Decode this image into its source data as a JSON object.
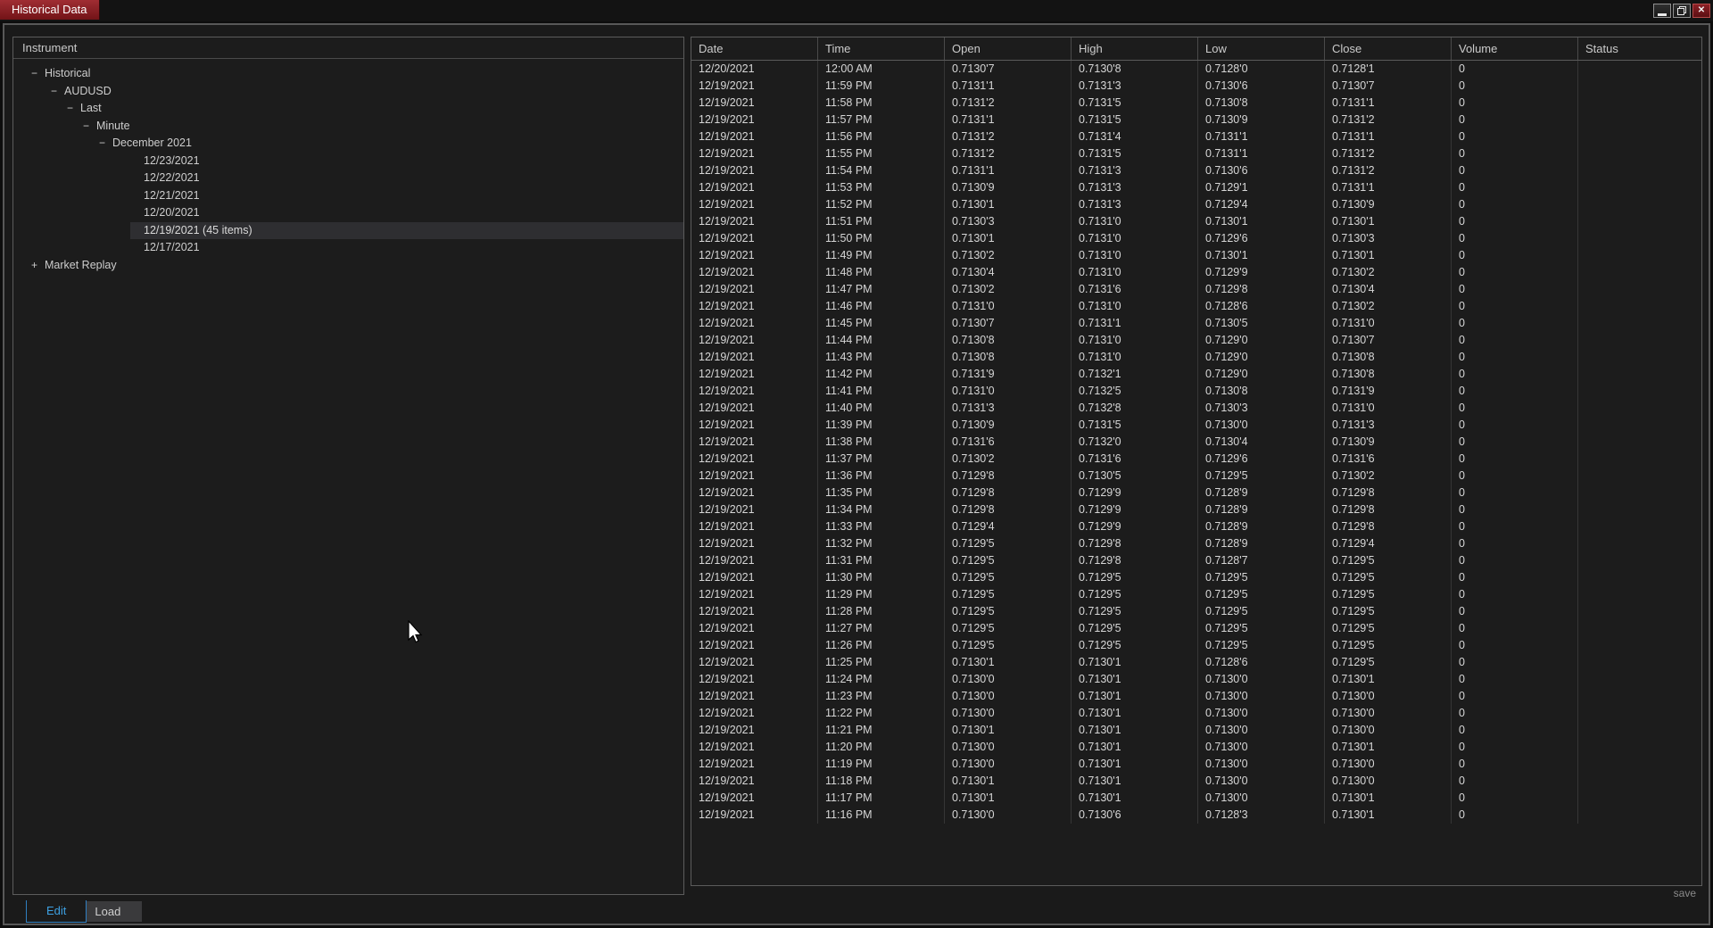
{
  "window": {
    "title": "Historical Data",
    "controls": {
      "minimize": "minimize-window",
      "restore": "restore-window",
      "close": "close-window",
      "close_glyph": "✕"
    }
  },
  "colors": {
    "title_tab_red": "#8e1c21",
    "active_tab_blue": "#3da0e2",
    "selected_tree_row_bg": "#2e2e31",
    "panel_border": "#5c5c5c",
    "background": "#1a1a1a"
  },
  "left_panel": {
    "header": "Instrument",
    "tree": [
      {
        "label": "Historical",
        "glyph": "−",
        "indent": 20,
        "selected": false
      },
      {
        "label": "AUDUSD",
        "glyph": "−",
        "indent": 42,
        "selected": false
      },
      {
        "label": "Last",
        "glyph": "−",
        "indent": 60,
        "selected": false
      },
      {
        "label": "Minute",
        "glyph": "−",
        "indent": 78,
        "selected": false
      },
      {
        "label": "December 2021",
        "glyph": "−",
        "indent": 96,
        "selected": false
      },
      {
        "label": "12/23/2021",
        "glyph": "",
        "indent": 131,
        "selected": false
      },
      {
        "label": "12/22/2021",
        "glyph": "",
        "indent": 131,
        "selected": false
      },
      {
        "label": "12/21/2021",
        "glyph": "",
        "indent": 131,
        "selected": false
      },
      {
        "label": "12/20/2021",
        "glyph": "",
        "indent": 131,
        "selected": false
      },
      {
        "label": "12/19/2021 (45 items)",
        "glyph": "",
        "indent": 131,
        "selected": true
      },
      {
        "label": "12/17/2021",
        "glyph": "",
        "indent": 131,
        "selected": false
      },
      {
        "label": "Market Replay",
        "glyph": "+",
        "indent": 20,
        "selected": false
      }
    ]
  },
  "table": {
    "columns": [
      "Date",
      "Time",
      "Open",
      "High",
      "Low",
      "Close",
      "Volume",
      "Status"
    ],
    "rows": [
      [
        "12/20/2021",
        "12:00 AM",
        "0.7130'7",
        "0.7130'8",
        "0.7128'0",
        "0.7128'1",
        "0",
        ""
      ],
      [
        "12/19/2021",
        "11:59 PM",
        "0.7131'1",
        "0.7131'3",
        "0.7130'6",
        "0.7130'7",
        "0",
        ""
      ],
      [
        "12/19/2021",
        "11:58 PM",
        "0.7131'2",
        "0.7131'5",
        "0.7130'8",
        "0.7131'1",
        "0",
        ""
      ],
      [
        "12/19/2021",
        "11:57 PM",
        "0.7131'1",
        "0.7131'5",
        "0.7130'9",
        "0.7131'2",
        "0",
        ""
      ],
      [
        "12/19/2021",
        "11:56 PM",
        "0.7131'2",
        "0.7131'4",
        "0.7131'1",
        "0.7131'1",
        "0",
        ""
      ],
      [
        "12/19/2021",
        "11:55 PM",
        "0.7131'2",
        "0.7131'5",
        "0.7131'1",
        "0.7131'2",
        "0",
        ""
      ],
      [
        "12/19/2021",
        "11:54 PM",
        "0.7131'1",
        "0.7131'3",
        "0.7130'6",
        "0.7131'2",
        "0",
        ""
      ],
      [
        "12/19/2021",
        "11:53 PM",
        "0.7130'9",
        "0.7131'3",
        "0.7129'1",
        "0.7131'1",
        "0",
        ""
      ],
      [
        "12/19/2021",
        "11:52 PM",
        "0.7130'1",
        "0.7131'3",
        "0.7129'4",
        "0.7130'9",
        "0",
        ""
      ],
      [
        "12/19/2021",
        "11:51 PM",
        "0.7130'3",
        "0.7131'0",
        "0.7130'1",
        "0.7130'1",
        "0",
        ""
      ],
      [
        "12/19/2021",
        "11:50 PM",
        "0.7130'1",
        "0.7131'0",
        "0.7129'6",
        "0.7130'3",
        "0",
        ""
      ],
      [
        "12/19/2021",
        "11:49 PM",
        "0.7130'2",
        "0.7131'0",
        "0.7130'1",
        "0.7130'1",
        "0",
        ""
      ],
      [
        "12/19/2021",
        "11:48 PM",
        "0.7130'4",
        "0.7131'0",
        "0.7129'9",
        "0.7130'2",
        "0",
        ""
      ],
      [
        "12/19/2021",
        "11:47 PM",
        "0.7130'2",
        "0.7131'6",
        "0.7129'8",
        "0.7130'4",
        "0",
        ""
      ],
      [
        "12/19/2021",
        "11:46 PM",
        "0.7131'0",
        "0.7131'0",
        "0.7128'6",
        "0.7130'2",
        "0",
        ""
      ],
      [
        "12/19/2021",
        "11:45 PM",
        "0.7130'7",
        "0.7131'1",
        "0.7130'5",
        "0.7131'0",
        "0",
        ""
      ],
      [
        "12/19/2021",
        "11:44 PM",
        "0.7130'8",
        "0.7131'0",
        "0.7129'0",
        "0.7130'7",
        "0",
        ""
      ],
      [
        "12/19/2021",
        "11:43 PM",
        "0.7130'8",
        "0.7131'0",
        "0.7129'0",
        "0.7130'8",
        "0",
        ""
      ],
      [
        "12/19/2021",
        "11:42 PM",
        "0.7131'9",
        "0.7132'1",
        "0.7129'0",
        "0.7130'8",
        "0",
        ""
      ],
      [
        "12/19/2021",
        "11:41 PM",
        "0.7131'0",
        "0.7132'5",
        "0.7130'8",
        "0.7131'9",
        "0",
        ""
      ],
      [
        "12/19/2021",
        "11:40 PM",
        "0.7131'3",
        "0.7132'8",
        "0.7130'3",
        "0.7131'0",
        "0",
        ""
      ],
      [
        "12/19/2021",
        "11:39 PM",
        "0.7130'9",
        "0.7131'5",
        "0.7130'0",
        "0.7131'3",
        "0",
        ""
      ],
      [
        "12/19/2021",
        "11:38 PM",
        "0.7131'6",
        "0.7132'0",
        "0.7130'4",
        "0.7130'9",
        "0",
        ""
      ],
      [
        "12/19/2021",
        "11:37 PM",
        "0.7130'2",
        "0.7131'6",
        "0.7129'6",
        "0.7131'6",
        "0",
        ""
      ],
      [
        "12/19/2021",
        "11:36 PM",
        "0.7129'8",
        "0.7130'5",
        "0.7129'5",
        "0.7130'2",
        "0",
        ""
      ],
      [
        "12/19/2021",
        "11:35 PM",
        "0.7129'8",
        "0.7129'9",
        "0.7128'9",
        "0.7129'8",
        "0",
        ""
      ],
      [
        "12/19/2021",
        "11:34 PM",
        "0.7129'8",
        "0.7129'9",
        "0.7128'9",
        "0.7129'8",
        "0",
        ""
      ],
      [
        "12/19/2021",
        "11:33 PM",
        "0.7129'4",
        "0.7129'9",
        "0.7128'9",
        "0.7129'8",
        "0",
        ""
      ],
      [
        "12/19/2021",
        "11:32 PM",
        "0.7129'5",
        "0.7129'8",
        "0.7128'9",
        "0.7129'4",
        "0",
        ""
      ],
      [
        "12/19/2021",
        "11:31 PM",
        "0.7129'5",
        "0.7129'8",
        "0.7128'7",
        "0.7129'5",
        "0",
        ""
      ],
      [
        "12/19/2021",
        "11:30 PM",
        "0.7129'5",
        "0.7129'5",
        "0.7129'5",
        "0.7129'5",
        "0",
        ""
      ],
      [
        "12/19/2021",
        "11:29 PM",
        "0.7129'5",
        "0.7129'5",
        "0.7129'5",
        "0.7129'5",
        "0",
        ""
      ],
      [
        "12/19/2021",
        "11:28 PM",
        "0.7129'5",
        "0.7129'5",
        "0.7129'5",
        "0.7129'5",
        "0",
        ""
      ],
      [
        "12/19/2021",
        "11:27 PM",
        "0.7129'5",
        "0.7129'5",
        "0.7129'5",
        "0.7129'5",
        "0",
        ""
      ],
      [
        "12/19/2021",
        "11:26 PM",
        "0.7129'5",
        "0.7129'5",
        "0.7129'5",
        "0.7129'5",
        "0",
        ""
      ],
      [
        "12/19/2021",
        "11:25 PM",
        "0.7130'1",
        "0.7130'1",
        "0.7128'6",
        "0.7129'5",
        "0",
        ""
      ],
      [
        "12/19/2021",
        "11:24 PM",
        "0.7130'0",
        "0.7130'1",
        "0.7130'0",
        "0.7130'1",
        "0",
        ""
      ],
      [
        "12/19/2021",
        "11:23 PM",
        "0.7130'0",
        "0.7130'1",
        "0.7130'0",
        "0.7130'0",
        "0",
        ""
      ],
      [
        "12/19/2021",
        "11:22 PM",
        "0.7130'0",
        "0.7130'1",
        "0.7130'0",
        "0.7130'0",
        "0",
        ""
      ],
      [
        "12/19/2021",
        "11:21 PM",
        "0.7130'1",
        "0.7130'1",
        "0.7130'0",
        "0.7130'0",
        "0",
        ""
      ],
      [
        "12/19/2021",
        "11:20 PM",
        "0.7130'0",
        "0.7130'1",
        "0.7130'0",
        "0.7130'1",
        "0",
        ""
      ],
      [
        "12/19/2021",
        "11:19 PM",
        "0.7130'0",
        "0.7130'1",
        "0.7130'0",
        "0.7130'0",
        "0",
        ""
      ],
      [
        "12/19/2021",
        "11:18 PM",
        "0.7130'1",
        "0.7130'1",
        "0.7130'0",
        "0.7130'0",
        "0",
        ""
      ],
      [
        "12/19/2021",
        "11:17 PM",
        "0.7130'1",
        "0.7130'1",
        "0.7130'0",
        "0.7130'1",
        "0",
        ""
      ],
      [
        "12/19/2021",
        "11:16 PM",
        "0.7130'0",
        "0.7130'6",
        "0.7128'3",
        "0.7130'1",
        "0",
        ""
      ]
    ]
  },
  "footer": {
    "tabs": [
      {
        "label": "Edit",
        "active": true
      },
      {
        "label": "Load",
        "active": false
      }
    ],
    "save_label": "save"
  }
}
